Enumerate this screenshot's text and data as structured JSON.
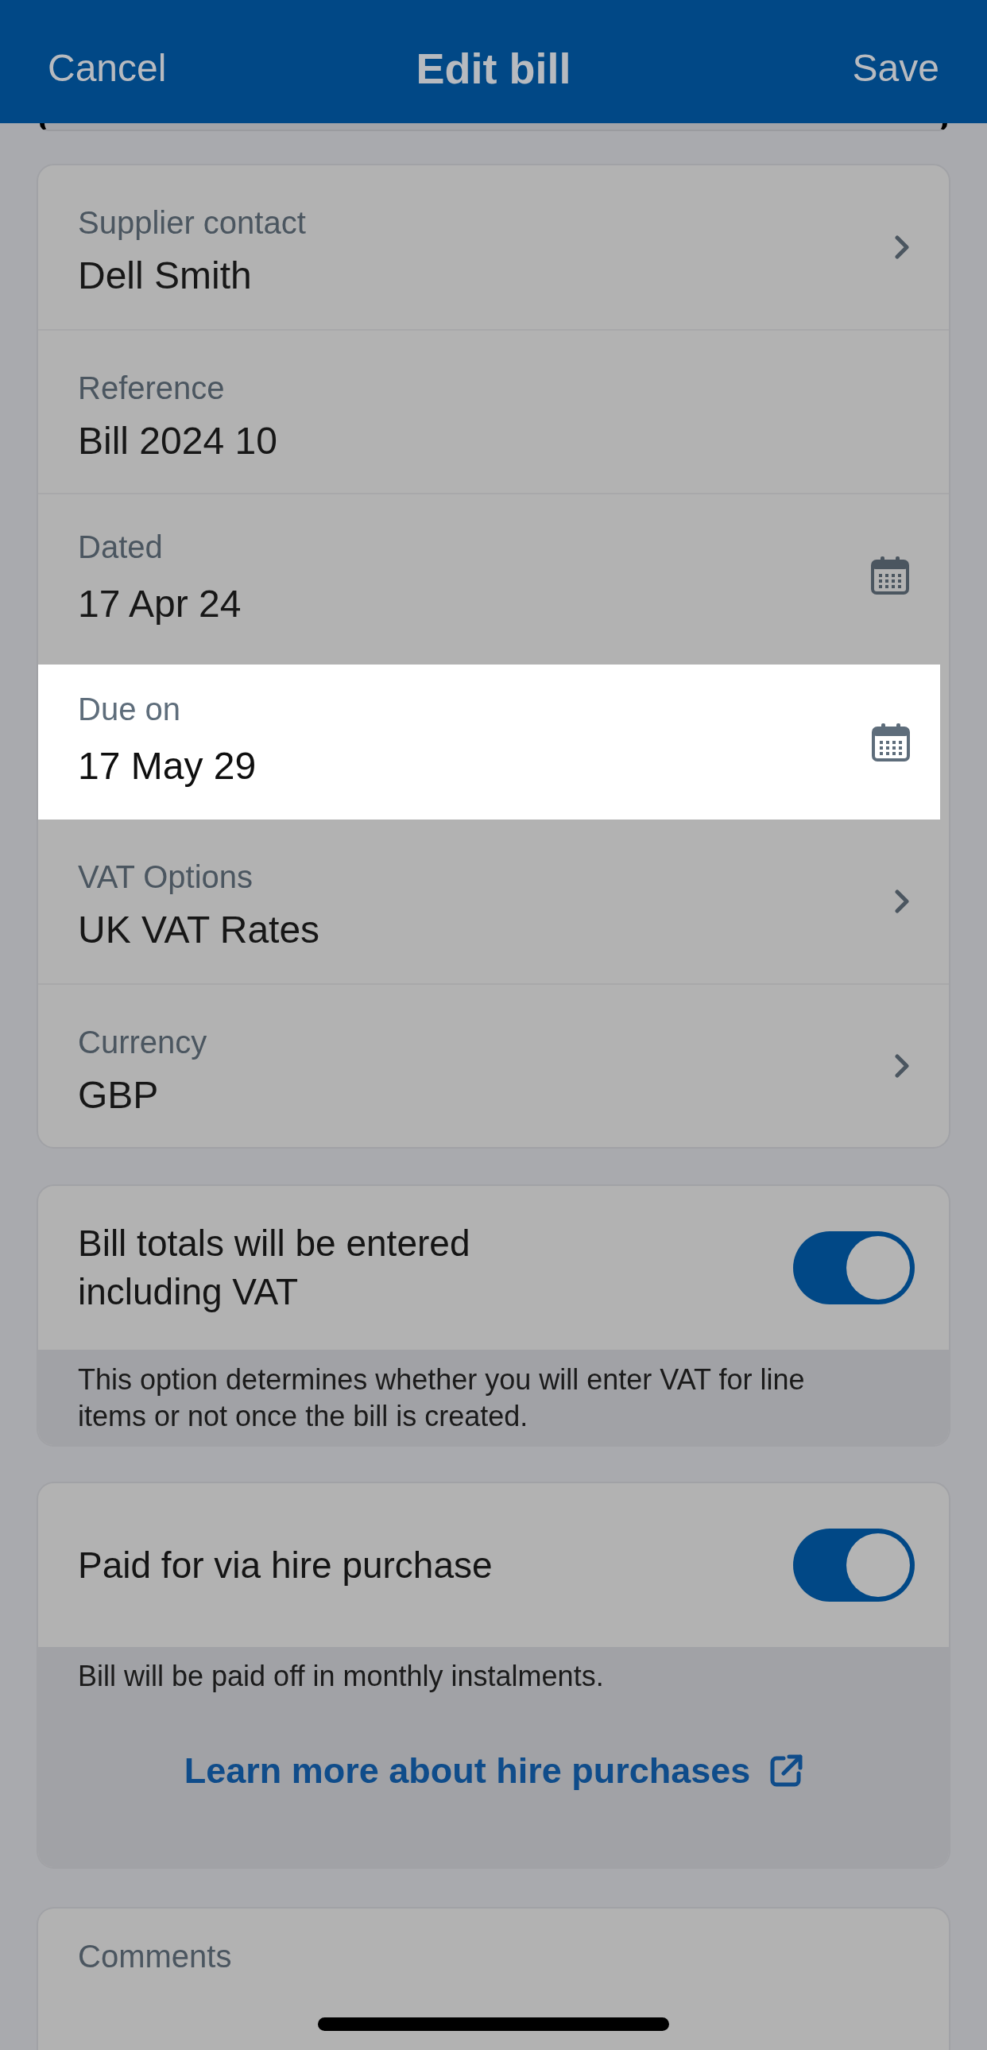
{
  "header": {
    "cancel": "Cancel",
    "title": "Edit bill",
    "save": "Save"
  },
  "fields": [
    {
      "kind": "picker",
      "label": "Supplier contact",
      "value": "Dell Smith",
      "highlighted": false
    },
    {
      "kind": "text",
      "label": "Reference",
      "value": "Bill 2024 10",
      "highlighted": false
    },
    {
      "kind": "date",
      "label": "Dated",
      "value": "17 Apr 24",
      "highlighted": false
    },
    {
      "kind": "date",
      "label": "Due on",
      "value": "17 May 29",
      "highlighted": true
    },
    {
      "kind": "picker",
      "label": "VAT Options",
      "value": "UK VAT Rates",
      "highlighted": false
    },
    {
      "kind": "picker",
      "label": "Currency",
      "value": "GBP",
      "highlighted": false
    }
  ],
  "toggle_cards": [
    {
      "label": "Bill totals will be entered including VAT",
      "on": true,
      "description": "This option determines whether you will enter VAT for line items or not once the bill is created."
    },
    {
      "label": "Paid for via hire purchase",
      "on": true,
      "description": "Bill will be paid off in monthly instalments.",
      "link": "Learn more about hire purchases"
    }
  ],
  "comments": {
    "label": "Comments"
  }
}
